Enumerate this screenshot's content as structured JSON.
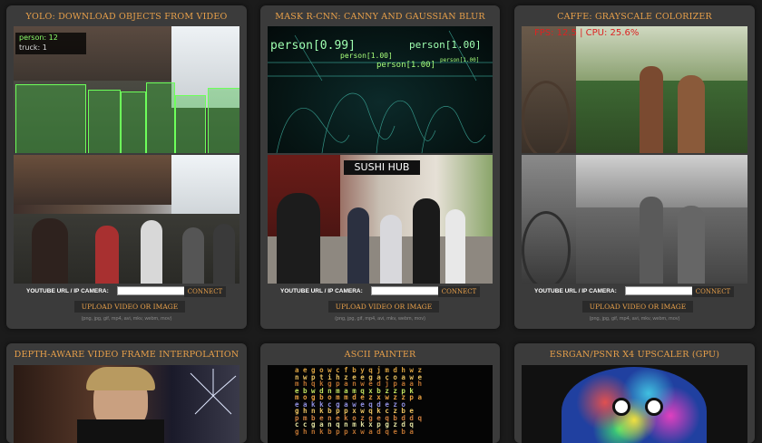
{
  "cards": [
    {
      "title": "YOLO: DOWNLOAD OBJECTS FROM VIDEO",
      "hud": [
        "person: 12",
        "truck: 1"
      ],
      "input_label": "YOUTUBE URL / IP CAMERA:",
      "input_value": "",
      "connect": "CONNECT",
      "upload": "UPLOAD VIDEO OR IMAGE",
      "formats": "(png, jpg, gif, mp4, avi, mkv, webm, mov)"
    },
    {
      "title": "MASK R-CNN: CANNY AND GAUSSIAN BLUR",
      "labels": [
        "person[0.99]",
        "person[1.00]",
        "person[1.00]",
        "person[1.00]",
        "person[1.00]"
      ],
      "input_label": "YOUTUBE URL / IP CAMERA:",
      "input_value": "",
      "connect": "CONNECT",
      "upload": "UPLOAD VIDEO OR IMAGE",
      "formats": "(png, jpg, gif, mp4, avi, mkv, webm, mov)"
    },
    {
      "title": "CAFFE: GRAYSCALE COLORIZER",
      "hud": "FPS: 12.5 | CPU: 25.6%",
      "input_label": "YOUTUBE URL / IP CAMERA:",
      "input_value": "",
      "connect": "CONNECT",
      "upload": "UPLOAD VIDEO OR IMAGE",
      "formats": "(png, jpg, gif, mp4, avi, mkv, webm, mov)"
    },
    {
      "title": "DEPTH-AWARE VIDEO FRAME INTERPOLATION"
    },
    {
      "title": "ASCII PAINTER"
    },
    {
      "title": "ESRGAN/PSNR X4 UPSCALER (GPU)"
    }
  ],
  "colors": {
    "accent": "#e8a04a",
    "card_bg": "#3b3b3b",
    "page_bg": "#1b1b1b"
  }
}
